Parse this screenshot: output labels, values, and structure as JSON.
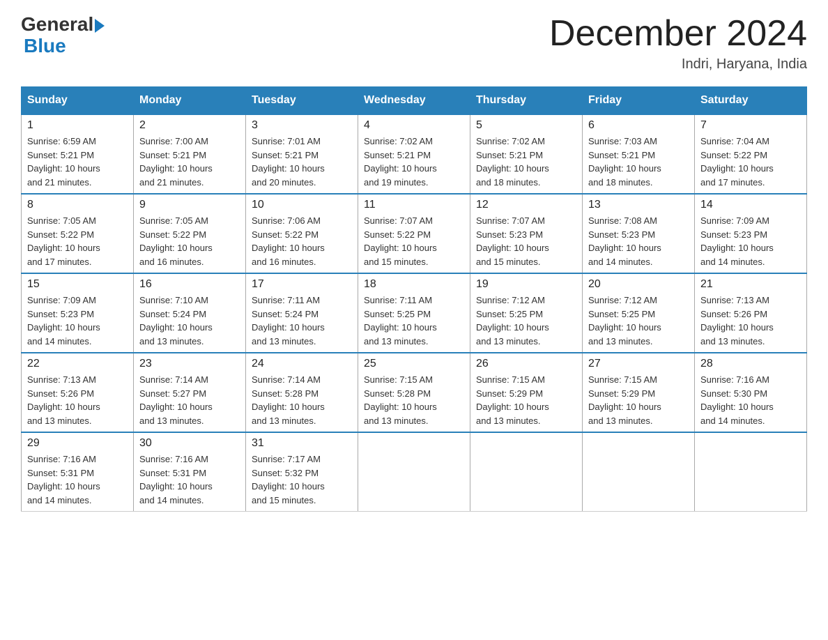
{
  "header": {
    "logo_general": "General",
    "logo_blue": "Blue",
    "month_title": "December 2024",
    "location": "Indri, Haryana, India"
  },
  "weekdays": [
    "Sunday",
    "Monday",
    "Tuesday",
    "Wednesday",
    "Thursday",
    "Friday",
    "Saturday"
  ],
  "weeks": [
    [
      {
        "day": "1",
        "sunrise": "6:59 AM",
        "sunset": "5:21 PM",
        "daylight": "10 hours and 21 minutes."
      },
      {
        "day": "2",
        "sunrise": "7:00 AM",
        "sunset": "5:21 PM",
        "daylight": "10 hours and 21 minutes."
      },
      {
        "day": "3",
        "sunrise": "7:01 AM",
        "sunset": "5:21 PM",
        "daylight": "10 hours and 20 minutes."
      },
      {
        "day": "4",
        "sunrise": "7:02 AM",
        "sunset": "5:21 PM",
        "daylight": "10 hours and 19 minutes."
      },
      {
        "day": "5",
        "sunrise": "7:02 AM",
        "sunset": "5:21 PM",
        "daylight": "10 hours and 18 minutes."
      },
      {
        "day": "6",
        "sunrise": "7:03 AM",
        "sunset": "5:21 PM",
        "daylight": "10 hours and 18 minutes."
      },
      {
        "day": "7",
        "sunrise": "7:04 AM",
        "sunset": "5:22 PM",
        "daylight": "10 hours and 17 minutes."
      }
    ],
    [
      {
        "day": "8",
        "sunrise": "7:05 AM",
        "sunset": "5:22 PM",
        "daylight": "10 hours and 17 minutes."
      },
      {
        "day": "9",
        "sunrise": "7:05 AM",
        "sunset": "5:22 PM",
        "daylight": "10 hours and 16 minutes."
      },
      {
        "day": "10",
        "sunrise": "7:06 AM",
        "sunset": "5:22 PM",
        "daylight": "10 hours and 16 minutes."
      },
      {
        "day": "11",
        "sunrise": "7:07 AM",
        "sunset": "5:22 PM",
        "daylight": "10 hours and 15 minutes."
      },
      {
        "day": "12",
        "sunrise": "7:07 AM",
        "sunset": "5:23 PM",
        "daylight": "10 hours and 15 minutes."
      },
      {
        "day": "13",
        "sunrise": "7:08 AM",
        "sunset": "5:23 PM",
        "daylight": "10 hours and 14 minutes."
      },
      {
        "day": "14",
        "sunrise": "7:09 AM",
        "sunset": "5:23 PM",
        "daylight": "10 hours and 14 minutes."
      }
    ],
    [
      {
        "day": "15",
        "sunrise": "7:09 AM",
        "sunset": "5:23 PM",
        "daylight": "10 hours and 14 minutes."
      },
      {
        "day": "16",
        "sunrise": "7:10 AM",
        "sunset": "5:24 PM",
        "daylight": "10 hours and 13 minutes."
      },
      {
        "day": "17",
        "sunrise": "7:11 AM",
        "sunset": "5:24 PM",
        "daylight": "10 hours and 13 minutes."
      },
      {
        "day": "18",
        "sunrise": "7:11 AM",
        "sunset": "5:25 PM",
        "daylight": "10 hours and 13 minutes."
      },
      {
        "day": "19",
        "sunrise": "7:12 AM",
        "sunset": "5:25 PM",
        "daylight": "10 hours and 13 minutes."
      },
      {
        "day": "20",
        "sunrise": "7:12 AM",
        "sunset": "5:25 PM",
        "daylight": "10 hours and 13 minutes."
      },
      {
        "day": "21",
        "sunrise": "7:13 AM",
        "sunset": "5:26 PM",
        "daylight": "10 hours and 13 minutes."
      }
    ],
    [
      {
        "day": "22",
        "sunrise": "7:13 AM",
        "sunset": "5:26 PM",
        "daylight": "10 hours and 13 minutes."
      },
      {
        "day": "23",
        "sunrise": "7:14 AM",
        "sunset": "5:27 PM",
        "daylight": "10 hours and 13 minutes."
      },
      {
        "day": "24",
        "sunrise": "7:14 AM",
        "sunset": "5:28 PM",
        "daylight": "10 hours and 13 minutes."
      },
      {
        "day": "25",
        "sunrise": "7:15 AM",
        "sunset": "5:28 PM",
        "daylight": "10 hours and 13 minutes."
      },
      {
        "day": "26",
        "sunrise": "7:15 AM",
        "sunset": "5:29 PM",
        "daylight": "10 hours and 13 minutes."
      },
      {
        "day": "27",
        "sunrise": "7:15 AM",
        "sunset": "5:29 PM",
        "daylight": "10 hours and 13 minutes."
      },
      {
        "day": "28",
        "sunrise": "7:16 AM",
        "sunset": "5:30 PM",
        "daylight": "10 hours and 14 minutes."
      }
    ],
    [
      {
        "day": "29",
        "sunrise": "7:16 AM",
        "sunset": "5:31 PM",
        "daylight": "10 hours and 14 minutes."
      },
      {
        "day": "30",
        "sunrise": "7:16 AM",
        "sunset": "5:31 PM",
        "daylight": "10 hours and 14 minutes."
      },
      {
        "day": "31",
        "sunrise": "7:17 AM",
        "sunset": "5:32 PM",
        "daylight": "10 hours and 15 minutes."
      },
      null,
      null,
      null,
      null
    ]
  ],
  "labels": {
    "sunrise": "Sunrise:",
    "sunset": "Sunset:",
    "daylight": "Daylight:"
  }
}
